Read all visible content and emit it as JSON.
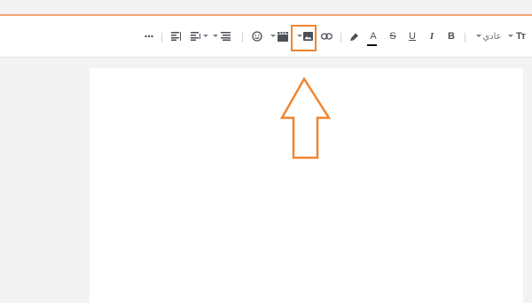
{
  "toolbar": {
    "more_icon": "more-icon",
    "style_select_value": "عادي",
    "text_size_label": "Tт",
    "bold_label": "B",
    "italic_label": "I",
    "underline_label": "U",
    "strikethrough_label": "S",
    "font_color_label": "A"
  },
  "colors": {
    "accent": "#f08530",
    "topline": "#f0a37a",
    "page_background": "#f3f3f3",
    "icon": "#4b4f56"
  }
}
